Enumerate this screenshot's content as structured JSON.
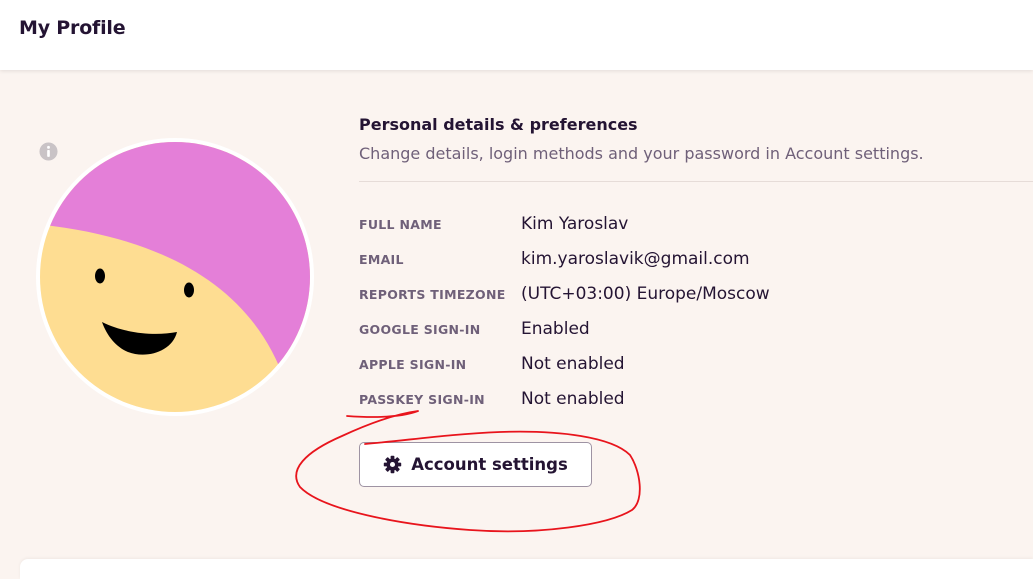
{
  "header": {
    "title": "My Profile"
  },
  "profile": {
    "section_title": "Personal details & preferences",
    "section_subtitle": "Change details, login methods and your password in Account settings.",
    "details": [
      {
        "label": "FULL NAME",
        "value": "Kim Yaroslav"
      },
      {
        "label": "EMAIL",
        "value": "kim.yaroslavik@gmail.com"
      },
      {
        "label": "REPORTS TIMEZONE",
        "value": "(UTC+03:00) Europe/Moscow"
      },
      {
        "label": "GOOGLE SIGN-IN",
        "value": "Enabled"
      },
      {
        "label": "APPLE SIGN-IN",
        "value": "Not enabled"
      },
      {
        "label": "PASSKEY SIGN-IN",
        "value": "Not enabled"
      }
    ],
    "account_button_label": "Account settings"
  },
  "icons": {
    "info": "info-icon",
    "gear": "gear-icon"
  },
  "colors": {
    "avatar_hair": "#e47fd8",
    "avatar_face": "#fedd92",
    "annotation": "#e8141c",
    "background": "#fbf4f0"
  }
}
